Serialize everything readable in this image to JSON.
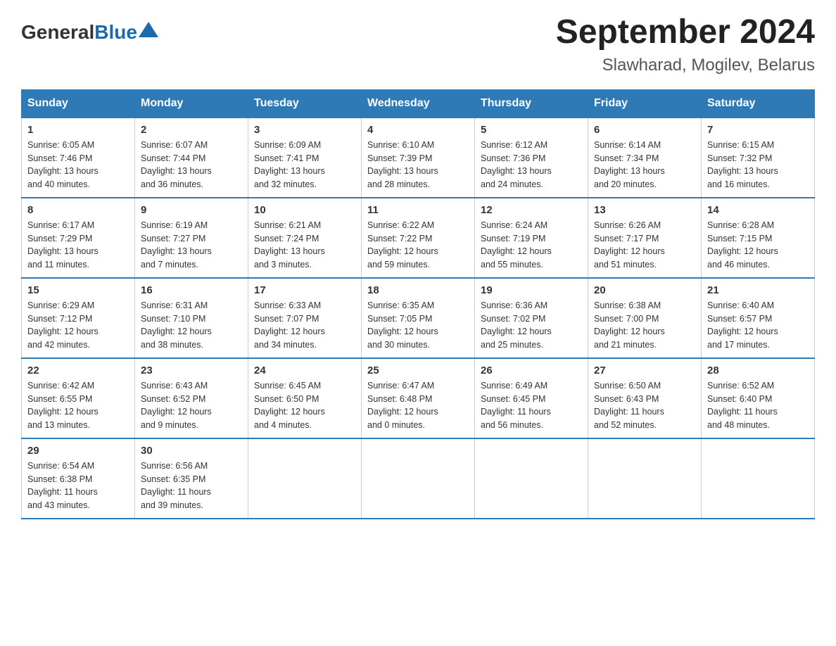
{
  "header": {
    "logo_general": "General",
    "logo_blue": "Blue",
    "title": "September 2024",
    "subtitle": "Slawharad, Mogilev, Belarus"
  },
  "weekdays": [
    "Sunday",
    "Monday",
    "Tuesday",
    "Wednesday",
    "Thursday",
    "Friday",
    "Saturday"
  ],
  "weeks": [
    [
      {
        "day": "1",
        "info": "Sunrise: 6:05 AM\nSunset: 7:46 PM\nDaylight: 13 hours\nand 40 minutes."
      },
      {
        "day": "2",
        "info": "Sunrise: 6:07 AM\nSunset: 7:44 PM\nDaylight: 13 hours\nand 36 minutes."
      },
      {
        "day": "3",
        "info": "Sunrise: 6:09 AM\nSunset: 7:41 PM\nDaylight: 13 hours\nand 32 minutes."
      },
      {
        "day": "4",
        "info": "Sunrise: 6:10 AM\nSunset: 7:39 PM\nDaylight: 13 hours\nand 28 minutes."
      },
      {
        "day": "5",
        "info": "Sunrise: 6:12 AM\nSunset: 7:36 PM\nDaylight: 13 hours\nand 24 minutes."
      },
      {
        "day": "6",
        "info": "Sunrise: 6:14 AM\nSunset: 7:34 PM\nDaylight: 13 hours\nand 20 minutes."
      },
      {
        "day": "7",
        "info": "Sunrise: 6:15 AM\nSunset: 7:32 PM\nDaylight: 13 hours\nand 16 minutes."
      }
    ],
    [
      {
        "day": "8",
        "info": "Sunrise: 6:17 AM\nSunset: 7:29 PM\nDaylight: 13 hours\nand 11 minutes."
      },
      {
        "day": "9",
        "info": "Sunrise: 6:19 AM\nSunset: 7:27 PM\nDaylight: 13 hours\nand 7 minutes."
      },
      {
        "day": "10",
        "info": "Sunrise: 6:21 AM\nSunset: 7:24 PM\nDaylight: 13 hours\nand 3 minutes."
      },
      {
        "day": "11",
        "info": "Sunrise: 6:22 AM\nSunset: 7:22 PM\nDaylight: 12 hours\nand 59 minutes."
      },
      {
        "day": "12",
        "info": "Sunrise: 6:24 AM\nSunset: 7:19 PM\nDaylight: 12 hours\nand 55 minutes."
      },
      {
        "day": "13",
        "info": "Sunrise: 6:26 AM\nSunset: 7:17 PM\nDaylight: 12 hours\nand 51 minutes."
      },
      {
        "day": "14",
        "info": "Sunrise: 6:28 AM\nSunset: 7:15 PM\nDaylight: 12 hours\nand 46 minutes."
      }
    ],
    [
      {
        "day": "15",
        "info": "Sunrise: 6:29 AM\nSunset: 7:12 PM\nDaylight: 12 hours\nand 42 minutes."
      },
      {
        "day": "16",
        "info": "Sunrise: 6:31 AM\nSunset: 7:10 PM\nDaylight: 12 hours\nand 38 minutes."
      },
      {
        "day": "17",
        "info": "Sunrise: 6:33 AM\nSunset: 7:07 PM\nDaylight: 12 hours\nand 34 minutes."
      },
      {
        "day": "18",
        "info": "Sunrise: 6:35 AM\nSunset: 7:05 PM\nDaylight: 12 hours\nand 30 minutes."
      },
      {
        "day": "19",
        "info": "Sunrise: 6:36 AM\nSunset: 7:02 PM\nDaylight: 12 hours\nand 25 minutes."
      },
      {
        "day": "20",
        "info": "Sunrise: 6:38 AM\nSunset: 7:00 PM\nDaylight: 12 hours\nand 21 minutes."
      },
      {
        "day": "21",
        "info": "Sunrise: 6:40 AM\nSunset: 6:57 PM\nDaylight: 12 hours\nand 17 minutes."
      }
    ],
    [
      {
        "day": "22",
        "info": "Sunrise: 6:42 AM\nSunset: 6:55 PM\nDaylight: 12 hours\nand 13 minutes."
      },
      {
        "day": "23",
        "info": "Sunrise: 6:43 AM\nSunset: 6:52 PM\nDaylight: 12 hours\nand 9 minutes."
      },
      {
        "day": "24",
        "info": "Sunrise: 6:45 AM\nSunset: 6:50 PM\nDaylight: 12 hours\nand 4 minutes."
      },
      {
        "day": "25",
        "info": "Sunrise: 6:47 AM\nSunset: 6:48 PM\nDaylight: 12 hours\nand 0 minutes."
      },
      {
        "day": "26",
        "info": "Sunrise: 6:49 AM\nSunset: 6:45 PM\nDaylight: 11 hours\nand 56 minutes."
      },
      {
        "day": "27",
        "info": "Sunrise: 6:50 AM\nSunset: 6:43 PM\nDaylight: 11 hours\nand 52 minutes."
      },
      {
        "day": "28",
        "info": "Sunrise: 6:52 AM\nSunset: 6:40 PM\nDaylight: 11 hours\nand 48 minutes."
      }
    ],
    [
      {
        "day": "29",
        "info": "Sunrise: 6:54 AM\nSunset: 6:38 PM\nDaylight: 11 hours\nand 43 minutes."
      },
      {
        "day": "30",
        "info": "Sunrise: 6:56 AM\nSunset: 6:35 PM\nDaylight: 11 hours\nand 39 minutes."
      },
      {
        "day": "",
        "info": ""
      },
      {
        "day": "",
        "info": ""
      },
      {
        "day": "",
        "info": ""
      },
      {
        "day": "",
        "info": ""
      },
      {
        "day": "",
        "info": ""
      }
    ]
  ]
}
